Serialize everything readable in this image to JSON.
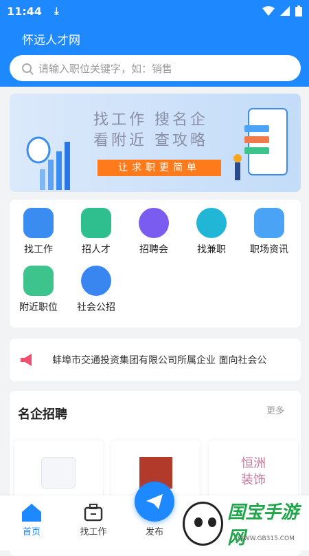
{
  "status": {
    "time": "11:44"
  },
  "header": {
    "title": "怀远人才网",
    "search_placeholder": "请输入职位关键字，如：销售"
  },
  "banner": {
    "line1": "找工作  搜名企",
    "line2": "看附近  查攻略",
    "cta": "让求职更简单"
  },
  "grid": [
    {
      "label": "找工作",
      "color": "#3a8cf0"
    },
    {
      "label": "招人才",
      "color": "#2fbf8f"
    },
    {
      "label": "招聘会",
      "color": "#7b5cf0"
    },
    {
      "label": "找兼职",
      "color": "#22b6d6"
    },
    {
      "label": "职场资讯",
      "color": "#4ba3f5"
    },
    {
      "label": "附近职位",
      "color": "#3dc48c"
    },
    {
      "label": "社会公招",
      "color": "#3a86f0"
    }
  ],
  "notice": {
    "text": "蚌埠市交通投资集团有限公司所属企业 面向社会公"
  },
  "companies": {
    "title": "名企招聘",
    "more": "更多",
    "logo3_text": "恒洲装饰"
  },
  "tabs": {
    "home": "首页",
    "jobs": "找工作",
    "publish": "发布"
  },
  "watermark": {
    "text": "国宝手游网",
    "url": "WWW.GB315.COM"
  }
}
